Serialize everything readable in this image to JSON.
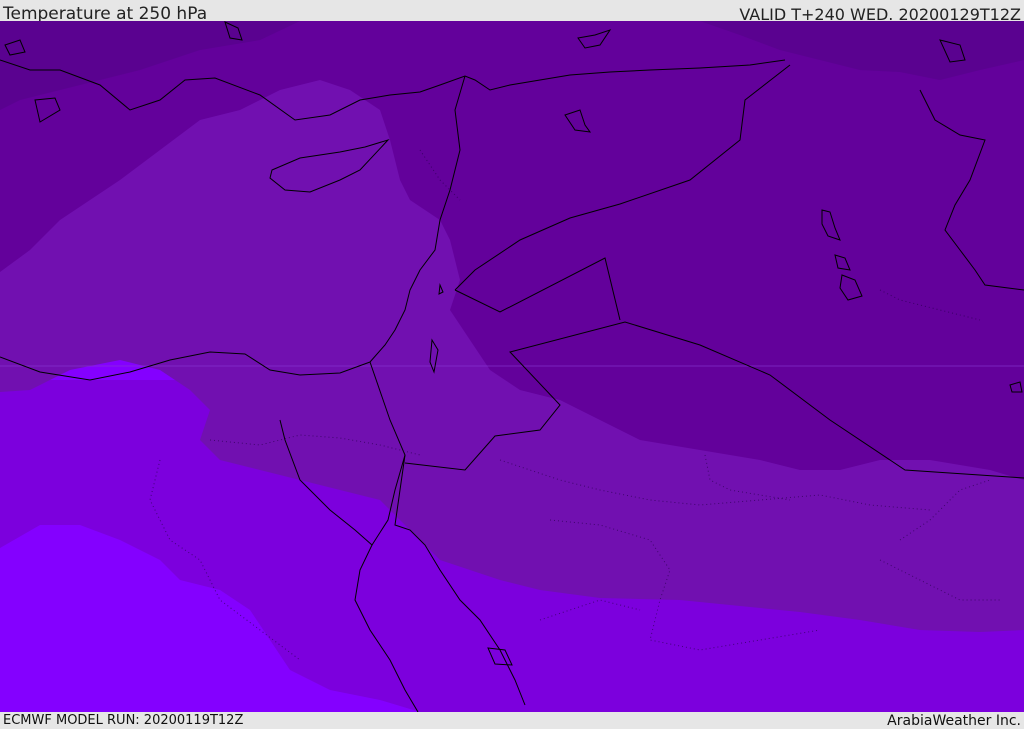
{
  "header": {
    "title": "Temperature at 250 hPa",
    "valid": "VALID T+240 WED. 20200129T12Z"
  },
  "footer": {
    "model_run": "ECMWF MODEL RUN: 20200119T12Z",
    "credit": "ArabiaWeather Inc."
  },
  "map": {
    "colors": {
      "band_darkest": "#5a0290",
      "band_dark": "#63019b",
      "band_mid": "#7110b0",
      "band_light": "#7c00dd",
      "band_lightest": "#8400ff",
      "coastline": "#000000"
    }
  }
}
